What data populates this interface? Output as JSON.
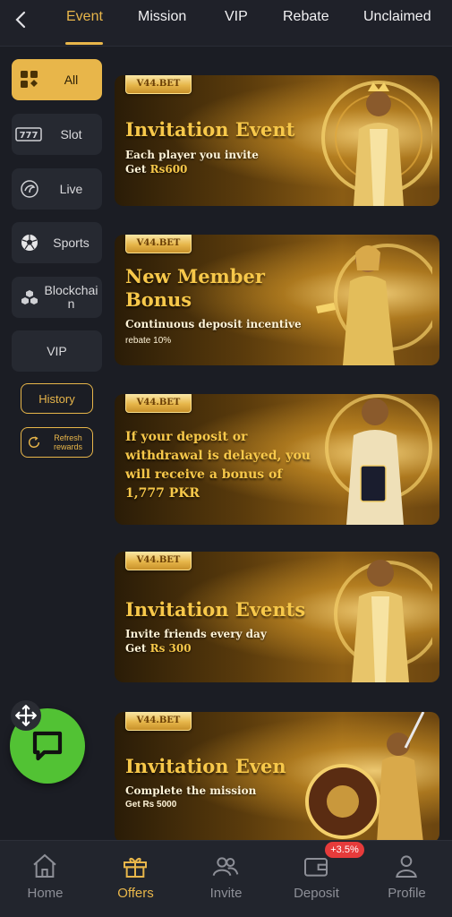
{
  "tabs": [
    {
      "label": "Event",
      "active": true
    },
    {
      "label": "Mission"
    },
    {
      "label": "VIP"
    },
    {
      "label": "Rebate"
    },
    {
      "label": "Unclaimed"
    }
  ],
  "sidebar": {
    "items": [
      {
        "label": "All",
        "icon": "grid-icon",
        "active": true
      },
      {
        "label": "Slot",
        "icon": "slot-777-icon"
      },
      {
        "label": "Live",
        "icon": "live-dealer-icon"
      },
      {
        "label": "Sports",
        "icon": "soccer-ball-icon"
      },
      {
        "label": "Blockchain",
        "icon": "blockchain-icon"
      },
      {
        "label": "VIP"
      }
    ],
    "history_label": "History",
    "refresh_label": "Refresh rewards"
  },
  "banners": [
    {
      "badge": "V44.BET",
      "title": "Invitation Event",
      "line1": "Each player you invite",
      "line2_prefix": "Get ",
      "line2_amount": "Rs600"
    },
    {
      "badge": "V44.BET",
      "title_line1": "New Member",
      "title_line2": "Bonus",
      "line1": "Continuous deposit incentive",
      "small": "rebate 10%"
    },
    {
      "badge": "V44.BET",
      "text_lines": [
        "If your deposit or",
        "withdrawal is delayed, you",
        "will receive a bonus of",
        "1,777 PKR"
      ]
    },
    {
      "badge": "V44.BET",
      "title": "Invitation Events",
      "line1": "Invite friends every day",
      "line2_prefix": "Get ",
      "line2_amount": "Rs 300"
    },
    {
      "badge": "V44.BET",
      "title": "Invitation Even",
      "line1": "Complete the mission",
      "small": "Get Rs 5000"
    }
  ],
  "bottom_nav": [
    {
      "label": "Home",
      "icon": "home-icon"
    },
    {
      "label": "Offers",
      "icon": "gift-icon",
      "active": true
    },
    {
      "label": "Invite",
      "icon": "invite-icon"
    },
    {
      "label": "Deposit",
      "icon": "wallet-icon",
      "badge": "+3.5%"
    },
    {
      "label": "Profile",
      "icon": "profile-icon"
    }
  ],
  "colors": {
    "accent": "#e8b64a",
    "background": "#1b1d24",
    "chat": "#52c234",
    "badge": "#e63b3b"
  }
}
